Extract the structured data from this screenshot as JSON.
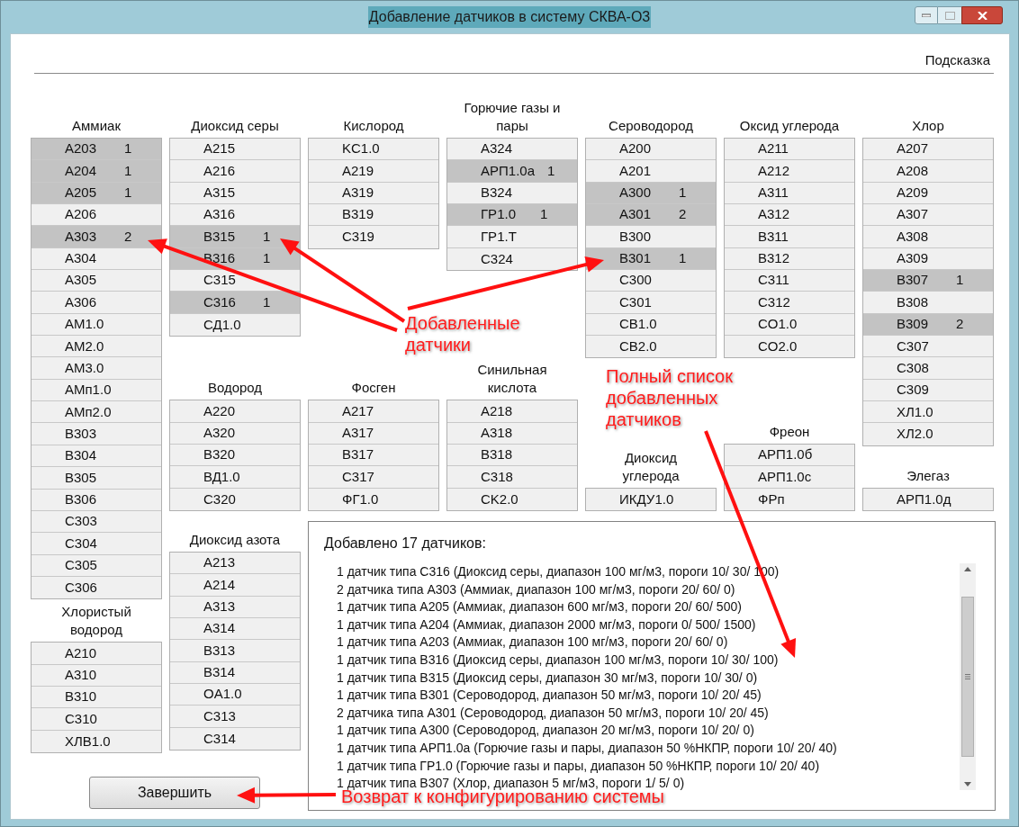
{
  "window": {
    "title": "Добавление датчиков в систему СКВА-О3"
  },
  "menu": {
    "hint": "Подсказка"
  },
  "columns": [
    {
      "groups": [
        {
          "title": "Аммиак",
          "items": [
            {
              "name": "A203",
              "count": "1",
              "selected": true
            },
            {
              "name": "A204",
              "count": "1",
              "selected": true
            },
            {
              "name": "A205",
              "count": "1",
              "selected": true
            },
            {
              "name": "A206",
              "selected": false
            },
            {
              "name": "A303",
              "count": "2",
              "selected": true
            },
            {
              "name": "A304",
              "selected": false
            },
            {
              "name": "A305",
              "selected": false
            },
            {
              "name": "A306",
              "selected": false
            },
            {
              "name": "AM1.0",
              "selected": false
            },
            {
              "name": "AM2.0",
              "selected": false
            },
            {
              "name": "AM3.0",
              "selected": false
            },
            {
              "name": "AMп1.0",
              "selected": false
            },
            {
              "name": "AMп2.0",
              "selected": false
            },
            {
              "name": "B303",
              "selected": false
            },
            {
              "name": "B304",
              "selected": false
            },
            {
              "name": "B305",
              "selected": false
            },
            {
              "name": "B306",
              "selected": false
            },
            {
              "name": "C303",
              "selected": false
            },
            {
              "name": "C304",
              "selected": false
            },
            {
              "name": "C305",
              "selected": false
            },
            {
              "name": "C306",
              "selected": false
            }
          ]
        },
        {
          "title": "Хлористый водород",
          "items": [
            {
              "name": "A210",
              "selected": false
            },
            {
              "name": "A310",
              "selected": false
            },
            {
              "name": "B310",
              "selected": false
            },
            {
              "name": "C310",
              "selected": false
            },
            {
              "name": "ХЛВ1.0",
              "selected": false
            }
          ]
        }
      ]
    },
    {
      "groups": [
        {
          "title": "Диоксид серы",
          "items": [
            {
              "name": "A215",
              "selected": false
            },
            {
              "name": "A216",
              "selected": false
            },
            {
              "name": "A315",
              "selected": false
            },
            {
              "name": "A316",
              "selected": false
            },
            {
              "name": "B315",
              "count": "1",
              "selected": true
            },
            {
              "name": "B316",
              "count": "1",
              "selected": true
            },
            {
              "name": "C315",
              "selected": false
            },
            {
              "name": "C316",
              "count": "1",
              "selected": true
            },
            {
              "name": "СД1.0",
              "selected": false
            }
          ]
        },
        {
          "title": "Водород",
          "items": [
            {
              "name": "A220",
              "selected": false
            },
            {
              "name": "A320",
              "selected": false
            },
            {
              "name": "B320",
              "selected": false
            },
            {
              "name": "ВД1.0",
              "selected": false
            },
            {
              "name": "C320",
              "selected": false
            }
          ]
        },
        {
          "title": "Диоксид азота",
          "items": [
            {
              "name": "A213",
              "selected": false
            },
            {
              "name": "A214",
              "selected": false
            },
            {
              "name": "A313",
              "selected": false
            },
            {
              "name": "A314",
              "selected": false
            },
            {
              "name": "B313",
              "selected": false
            },
            {
              "name": "B314",
              "selected": false
            },
            {
              "name": "OA1.0",
              "selected": false
            },
            {
              "name": "C313",
              "selected": false
            },
            {
              "name": "C314",
              "selected": false
            }
          ]
        }
      ]
    },
    {
      "groups": [
        {
          "title": "Кислород",
          "items": [
            {
              "name": "KC1.0",
              "selected": false
            },
            {
              "name": "A219",
              "selected": false
            },
            {
              "name": "A319",
              "selected": false
            },
            {
              "name": "B319",
              "selected": false
            },
            {
              "name": "C319",
              "selected": false
            }
          ]
        },
        {
          "title": "Фосген",
          "items": [
            {
              "name": "A217",
              "selected": false
            },
            {
              "name": "A317",
              "selected": false
            },
            {
              "name": "B317",
              "selected": false
            },
            {
              "name": "C317",
              "selected": false
            },
            {
              "name": "ФГ1.0",
              "selected": false
            }
          ]
        }
      ]
    },
    {
      "groups": [
        {
          "title": "Горючие газы и пары",
          "items": [
            {
              "name": "A324",
              "selected": false
            },
            {
              "name": "АРП1.0а",
              "count": "1",
              "selected": true
            },
            {
              "name": "B324",
              "selected": false
            },
            {
              "name": "ГР1.0",
              "count": "1",
              "selected": true
            },
            {
              "name": "ГР1.Т",
              "selected": false
            },
            {
              "name": "C324",
              "selected": false
            }
          ]
        },
        {
          "title": "Синильная кислота",
          "items": [
            {
              "name": "A218",
              "selected": false
            },
            {
              "name": "A318",
              "selected": false
            },
            {
              "name": "B318",
              "selected": false
            },
            {
              "name": "C318",
              "selected": false
            },
            {
              "name": "CK2.0",
              "selected": false
            }
          ]
        }
      ]
    },
    {
      "groups": [
        {
          "title": "Сероводород",
          "items": [
            {
              "name": "A200",
              "selected": false
            },
            {
              "name": "A201",
              "selected": false
            },
            {
              "name": "A300",
              "count": "1",
              "selected": true
            },
            {
              "name": "A301",
              "count": "2",
              "selected": true
            },
            {
              "name": "B300",
              "selected": false
            },
            {
              "name": "B301",
              "count": "1",
              "selected": true
            },
            {
              "name": "C300",
              "selected": false
            },
            {
              "name": "C301",
              "selected": false
            },
            {
              "name": "CB1.0",
              "selected": false
            },
            {
              "name": "CB2.0",
              "selected": false
            }
          ]
        },
        {
          "title": "Диоксид углерода",
          "items": [
            {
              "name": "ИКДУ1.0",
              "selected": false
            }
          ]
        }
      ]
    },
    {
      "groups": [
        {
          "title": "Оксид углерода",
          "items": [
            {
              "name": "A211",
              "selected": false
            },
            {
              "name": "A212",
              "selected": false
            },
            {
              "name": "A311",
              "selected": false
            },
            {
              "name": "A312",
              "selected": false
            },
            {
              "name": "B311",
              "selected": false
            },
            {
              "name": "B312",
              "selected": false
            },
            {
              "name": "C311",
              "selected": false
            },
            {
              "name": "C312",
              "selected": false
            },
            {
              "name": "CO1.0",
              "selected": false
            },
            {
              "name": "CO2.0",
              "selected": false
            }
          ]
        },
        {
          "title": "Фреон",
          "items": [
            {
              "name": "АРП1.0б",
              "selected": false
            },
            {
              "name": "АРП1.0с",
              "selected": false
            },
            {
              "name": "ФРп",
              "selected": false
            }
          ]
        }
      ]
    },
    {
      "groups": [
        {
          "title": "Хлор",
          "items": [
            {
              "name": "A207",
              "selected": false
            },
            {
              "name": "A208",
              "selected": false
            },
            {
              "name": "A209",
              "selected": false
            },
            {
              "name": "A307",
              "selected": false
            },
            {
              "name": "A308",
              "selected": false
            },
            {
              "name": "A309",
              "selected": false
            },
            {
              "name": "B307",
              "count": "1",
              "selected": true
            },
            {
              "name": "B308",
              "selected": false
            },
            {
              "name": "B309",
              "count": "2",
              "selected": true
            },
            {
              "name": "C307",
              "selected": false
            },
            {
              "name": "C308",
              "selected": false
            },
            {
              "name": "C309",
              "selected": false
            },
            {
              "name": "ХЛ1.0",
              "selected": false
            },
            {
              "name": "ХЛ2.0",
              "selected": false
            }
          ]
        },
        {
          "title": "Элегаз",
          "items": [
            {
              "name": "АРП1.0д",
              "selected": false
            }
          ]
        }
      ]
    }
  ],
  "summary": {
    "title": "Добавлено 17 датчиков:",
    "lines": [
      "1 датчик типа C316 (Диоксид серы, диапазон 100 мг/м3, пороги 10/ 30/ 100)",
      "2 датчика типа A303 (Аммиак, диапазон 100 мг/м3, пороги 20/ 60/ 0)",
      "1 датчик типа A205 (Аммиак, диапазон 600 мг/м3, пороги 20/ 60/ 500)",
      "1 датчик типа A204 (Аммиак, диапазон 2000 мг/м3, пороги 0/ 500/ 1500)",
      "1 датчик типа A203 (Аммиак, диапазон 100 мг/м3, пороги 20/ 60/ 0)",
      "1 датчик типа B316 (Диоксид серы, диапазон 100 мг/м3, пороги 10/ 30/ 100)",
      "1 датчик типа B315 (Диоксид серы, диапазон 30 мг/м3, пороги 10/ 30/ 0)",
      "1 датчик типа B301 (Сероводород, диапазон 50 мг/м3, пороги 10/ 20/ 45)",
      "2 датчика типа A301 (Сероводород, диапазон 50 мг/м3, пороги 10/ 20/ 45)",
      "1 датчик типа A300 (Сероводород, диапазон 20 мг/м3, пороги 10/ 20/ 0)",
      "1 датчик типа АРП1.0а (Горючие газы и пары, диапазон 50 %НКПР, пороги 10/ 20/ 40)",
      "1 датчик типа ГР1.0 (Горючие газы и пары, диапазон 50 %НКПР, пороги 10/ 20/ 40)",
      "1 датчик типа B307 (Хлор, диапазон 5 мг/м3, пороги 1/ 5/ 0)"
    ]
  },
  "finish_button": "Завершить",
  "annotations": [
    "Добавленные датчики",
    "Полный список добавленных датчиков",
    "Возврат к конфигурированию системы"
  ]
}
